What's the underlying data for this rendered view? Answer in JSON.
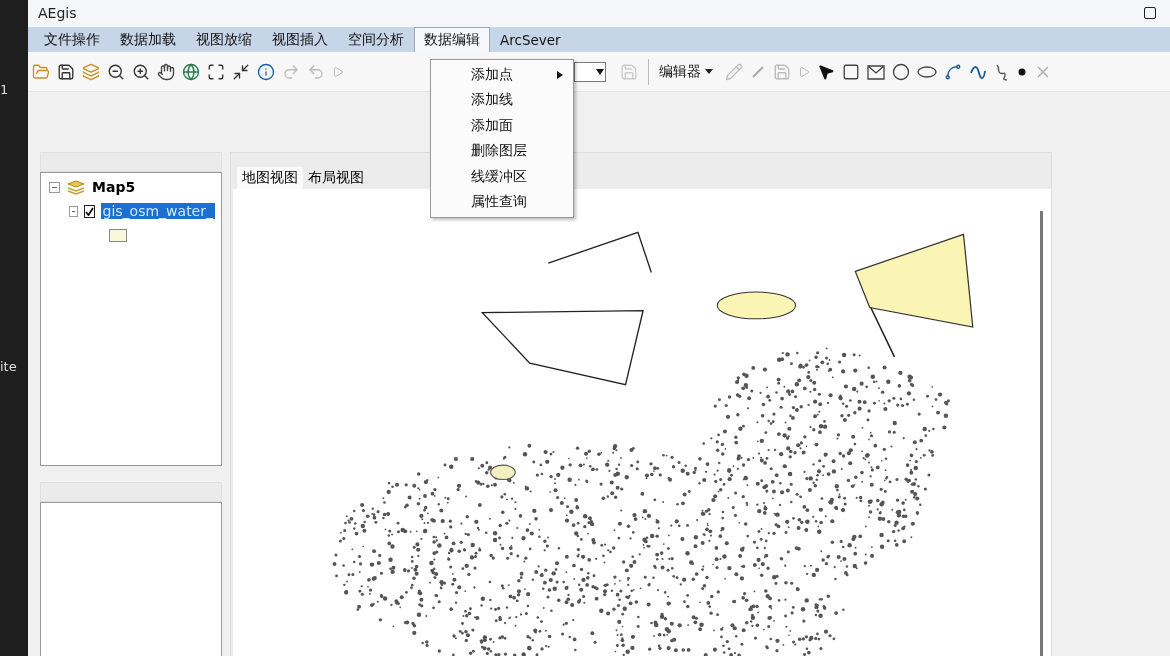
{
  "window": {
    "title": "AEgis"
  },
  "desktop_edge": [
    "1",
    "ite"
  ],
  "menu": [
    {
      "label": "文件操作",
      "selected": false
    },
    {
      "label": "数据加载",
      "selected": false
    },
    {
      "label": "视图放缩",
      "selected": false
    },
    {
      "label": "视图插入",
      "selected": false
    },
    {
      "label": "空间分析",
      "selected": false
    },
    {
      "label": "数据编辑",
      "selected": true
    },
    {
      "label": "ArcSever",
      "selected": false
    }
  ],
  "dropdown": [
    {
      "label": "添加点",
      "submenu": true
    },
    {
      "label": "添加线",
      "submenu": false
    },
    {
      "label": "添加面",
      "submenu": false
    },
    {
      "label": "删除图层",
      "submenu": false
    },
    {
      "label": "线缓冲区",
      "submenu": false
    },
    {
      "label": "属性查询",
      "submenu": false
    }
  ],
  "editor_toolbar": {
    "label": "编辑器"
  },
  "toc": {
    "label": "Map5",
    "expanded": true,
    "children": [
      {
        "label": "gis_osm_water_",
        "checked": true,
        "selected": true,
        "expanded": true
      }
    ]
  },
  "tabs": [
    {
      "label": "地图视图",
      "selected": true
    },
    {
      "label": "布局视图",
      "selected": false
    }
  ]
}
